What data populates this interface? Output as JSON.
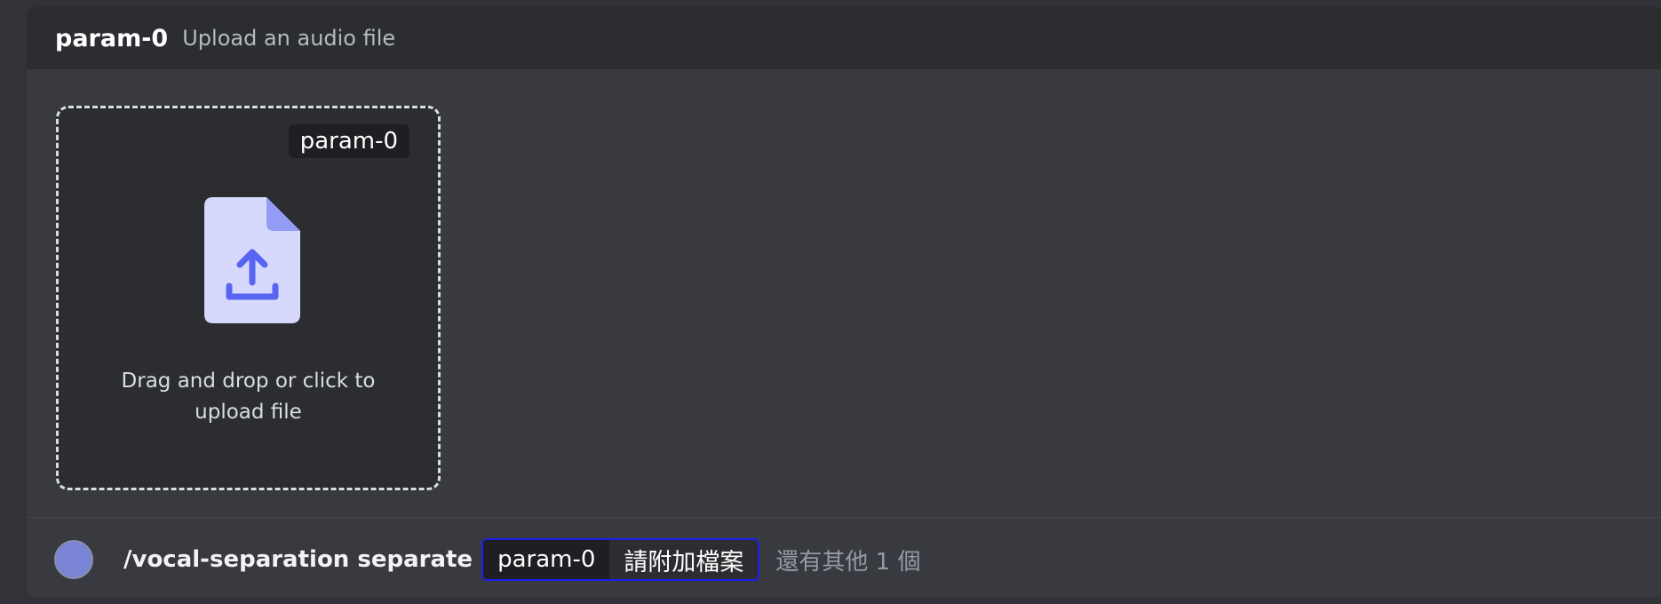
{
  "header": {
    "param_name": "param-0",
    "description": "Upload an audio file"
  },
  "dropzone": {
    "tag": "param-0",
    "line1": "Drag and drop or click to",
    "line2": "upload file",
    "icon": "file-upload-icon"
  },
  "command": {
    "avatar_color": "#7984d4",
    "text": "/vocal-separation separate",
    "chip_name": "param-0",
    "chip_value": "請附加檔案",
    "more": "還有其他 1 個",
    "chip_border_color": "#1a1ff0"
  }
}
